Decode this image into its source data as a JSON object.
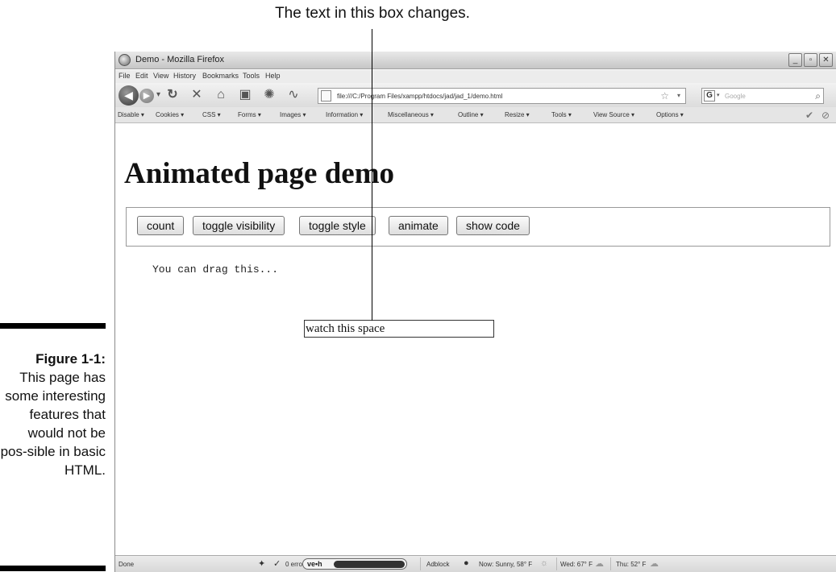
{
  "callout": {
    "text": "The text in this box changes."
  },
  "caption": {
    "figure_label": "Figure 1-1:",
    "text": "This page has some interesting features that would not be pos-sible in basic HTML."
  },
  "window": {
    "title": "Demo - Mozilla Firefox",
    "controls": [
      "_",
      "▫",
      "✕"
    ]
  },
  "menubar": {
    "items": [
      "File",
      "Edit",
      "View",
      "History",
      "Bookmarks",
      "Tools",
      "Help"
    ]
  },
  "navbar": {
    "back_glyph": "◀",
    "forward_glyph": "▶",
    "url": "file:///C:/Program Files/xampp/htdocs/jad/jad_1/demo.html",
    "search_placeholder": "Google",
    "search_engine_letter": "G"
  },
  "devbar": {
    "items": [
      "Disable ▾",
      "Cookies ▾",
      "CSS ▾",
      "Forms ▾",
      "Images ▾",
      "Information ▾",
      "Miscellaneous ▾",
      "Outline ▾",
      "Resize ▾",
      "Tools ▾",
      "View Source ▾",
      "Options ▾"
    ]
  },
  "page": {
    "title": "Animated page demo",
    "buttons": [
      "count",
      "toggle visibility",
      "toggle style",
      "animate",
      "show code"
    ],
    "drag_text": "You can drag this...",
    "watch_text": "watch this space"
  },
  "statusbar": {
    "status": "Done",
    "errors": "0 errors / 0 warnings",
    "vetch": "ve•h",
    "adblock": "Adblock",
    "weather_now": "Now: Sunny, 58° F",
    "weather_wed": "Wed: 67° F",
    "weather_thu": "Thu: 52° F"
  }
}
